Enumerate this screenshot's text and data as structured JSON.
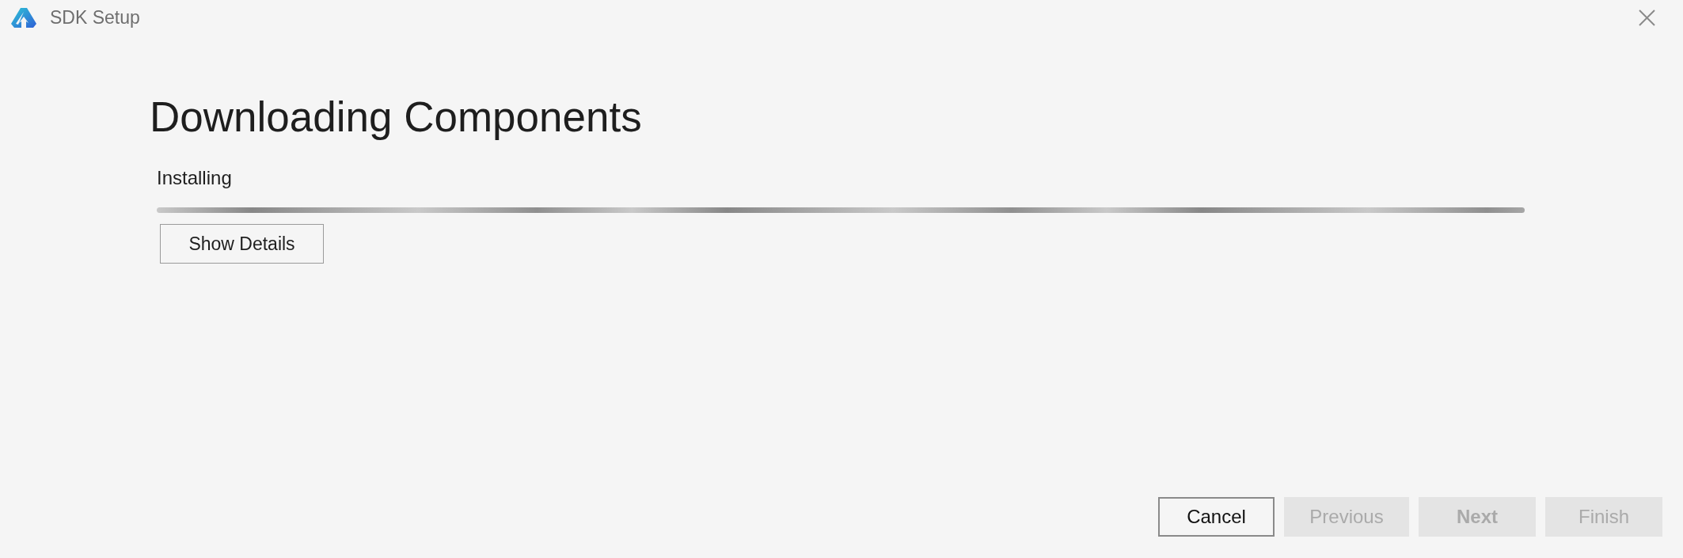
{
  "window": {
    "title": "SDK Setup"
  },
  "heading": "Downloading Components",
  "status": "Installing",
  "progress": {
    "indeterminate": true
  },
  "details_button": {
    "label": "Show Details"
  },
  "buttons": [
    {
      "label": "Cancel",
      "disabled": false,
      "default": false
    },
    {
      "label": "Previous",
      "disabled": true,
      "default": false
    },
    {
      "label": "Next",
      "disabled": true,
      "default": true
    },
    {
      "label": "Finish",
      "disabled": true,
      "default": false
    }
  ]
}
